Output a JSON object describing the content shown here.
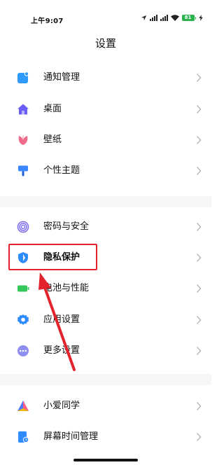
{
  "status_bar": {
    "time": "上午9:07",
    "battery": "81"
  },
  "header": {
    "title": "设置"
  },
  "settings": [
    {
      "label": "通知管理",
      "icon": "notification-icon",
      "color": "#2f9bff"
    },
    {
      "label": "桌面",
      "icon": "home-icon",
      "color": "#6a5cf6"
    },
    {
      "label": "壁纸",
      "icon": "wallpaper-flower-icon",
      "color": "#f06a8a"
    },
    {
      "label": "个性主题",
      "icon": "theme-brush-icon",
      "color": "#3a86ff"
    },
    {
      "label": "密码与安全",
      "icon": "fingerprint-icon",
      "color": "#7c6cf0"
    },
    {
      "label": "隐私保护",
      "icon": "privacy-shield-icon",
      "color": "#2f8cff"
    },
    {
      "label": "电池与性能",
      "icon": "battery-icon",
      "color": "#34c759"
    },
    {
      "label": "应用设置",
      "icon": "gear-icon",
      "color": "#2f8cff"
    },
    {
      "label": "更多设置",
      "icon": "more-icon",
      "color": "#8e8ef0"
    },
    {
      "label": "小爱同学",
      "icon": "xiaoai-icon",
      "color": "#4a7bff"
    },
    {
      "label": "屏幕时间管理",
      "icon": "screen-time-icon",
      "color": "#2f8cff"
    }
  ],
  "annotation": {
    "highlight_color": "#e3232c"
  }
}
